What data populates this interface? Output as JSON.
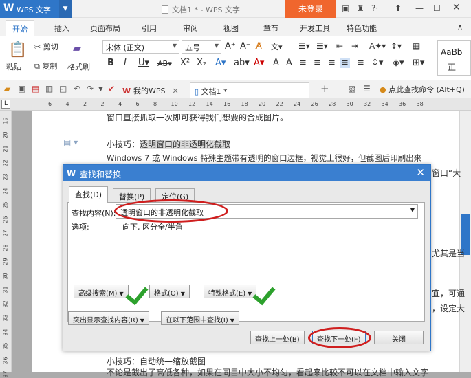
{
  "app": {
    "logo": "W",
    "name": "WPS 文字",
    "title": "文档1 * - WPS 文字",
    "login": "未登录"
  },
  "tabs": [
    "开始",
    "插入",
    "页面布局",
    "引用",
    "审阅",
    "视图",
    "章节",
    "开发工具",
    "特色功能"
  ],
  "ribbon": {
    "paste": "粘贴",
    "cut": "剪切",
    "copy": "复制",
    "format_painter": "格式刷",
    "font_name": "宋体 (正文)",
    "font_size": "五号",
    "style_preview": "AaBb",
    "style_preview2": "正"
  },
  "doc_tabs": [
    "我的WPS",
    "文档1 *"
  ],
  "find_command": "点此查找命令 (Alt+Q)",
  "ruler_h": [
    "6",
    "4",
    "2",
    "2",
    "4",
    "6",
    "8",
    "10",
    "12",
    "14",
    "16",
    "18",
    "20",
    "22",
    "24",
    "26",
    "28",
    "30",
    "32",
    "34",
    "36",
    "38"
  ],
  "ruler_v": [
    "19",
    "20",
    "21",
    "22",
    "23",
    "24",
    "25",
    "26",
    "27",
    "28",
    "29",
    "30",
    "31",
    "32",
    "33",
    "34",
    "35",
    "36",
    "37"
  ],
  "document": {
    "line_top": "窗口直接抓取一次即可获得我们想要的合成图片。",
    "tip1_prefix": "小技巧：",
    "tip1_highlight": "透明窗口的非透明化截取",
    "tip1_body": "Windows 7 或 Windows 特殊主题带有透明的窗口边框，视觉上很好，但截图后印刷出来",
    "right_frag1": "窗口“大",
    "right_frag2": "尤其是当",
    "right_frag3": "宜，可通",
    "right_frag4": "，设定大",
    "tip2": "小技巧：自动统一缩放截图",
    "bottom_line": "不论是截出了高低各种，如果在同目中大小不均匀，看起来比较不可以在文档中输入文字"
  },
  "dialog": {
    "title": "查找和替换",
    "tabs": [
      "查找(D)",
      "替换(P)",
      "定位(G)"
    ],
    "find_label": "查找内容(N):",
    "find_value": "透明窗口的非透明化截取",
    "options_label": "选项:",
    "options_value": "向下, 区分全/半角",
    "advanced": "高级搜索(M)",
    "format": "格式(O)",
    "special": "特殊格式(E)",
    "highlight": "突出显示查找内容(R)",
    "find_in": "在以下范围中查找(I)",
    "find_prev": "查找上一处(B)",
    "find_next": "查找下一处(F)",
    "close": "关闭"
  }
}
